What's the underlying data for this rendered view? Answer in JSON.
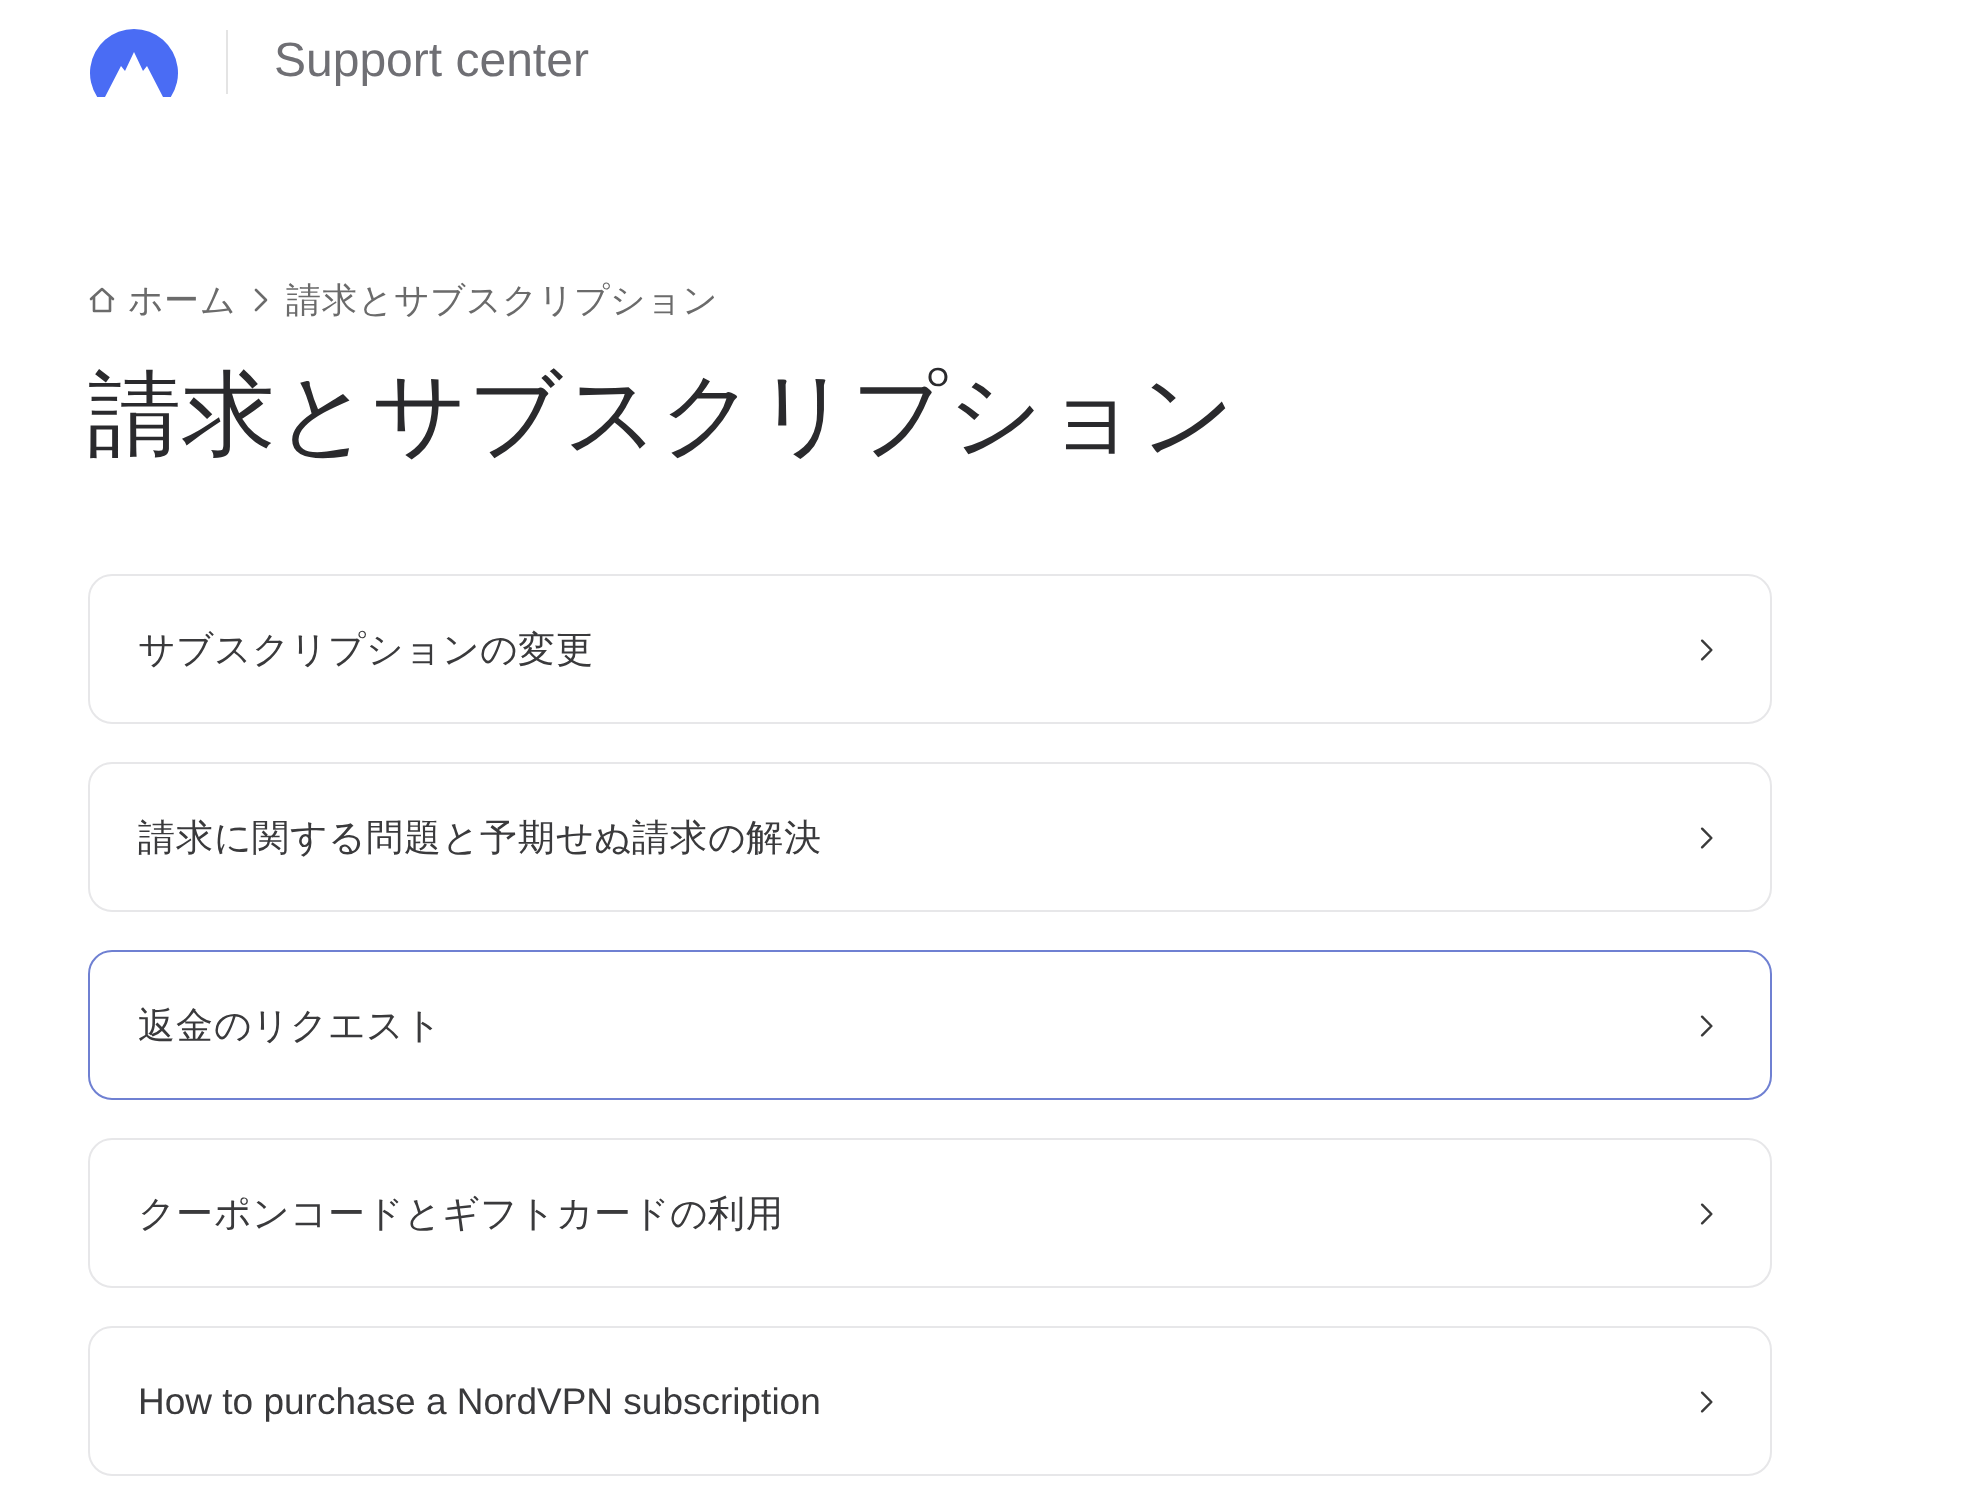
{
  "header": {
    "title": "Support center"
  },
  "breadcrumb": {
    "home": "ホーム",
    "current": "請求とサブスクリプション"
  },
  "heading": "請求とサブスクリプション",
  "articles": [
    {
      "label": "サブスクリプションの変更",
      "highlighted": false
    },
    {
      "label": "請求に関する問題と予期せぬ請求の解決",
      "highlighted": false
    },
    {
      "label": "返金のリクエスト",
      "highlighted": true
    },
    {
      "label": "クーポンコードとギフトカードの利用",
      "highlighted": false
    },
    {
      "label": "How to purchase a NordVPN subscription",
      "highlighted": false
    }
  ]
}
